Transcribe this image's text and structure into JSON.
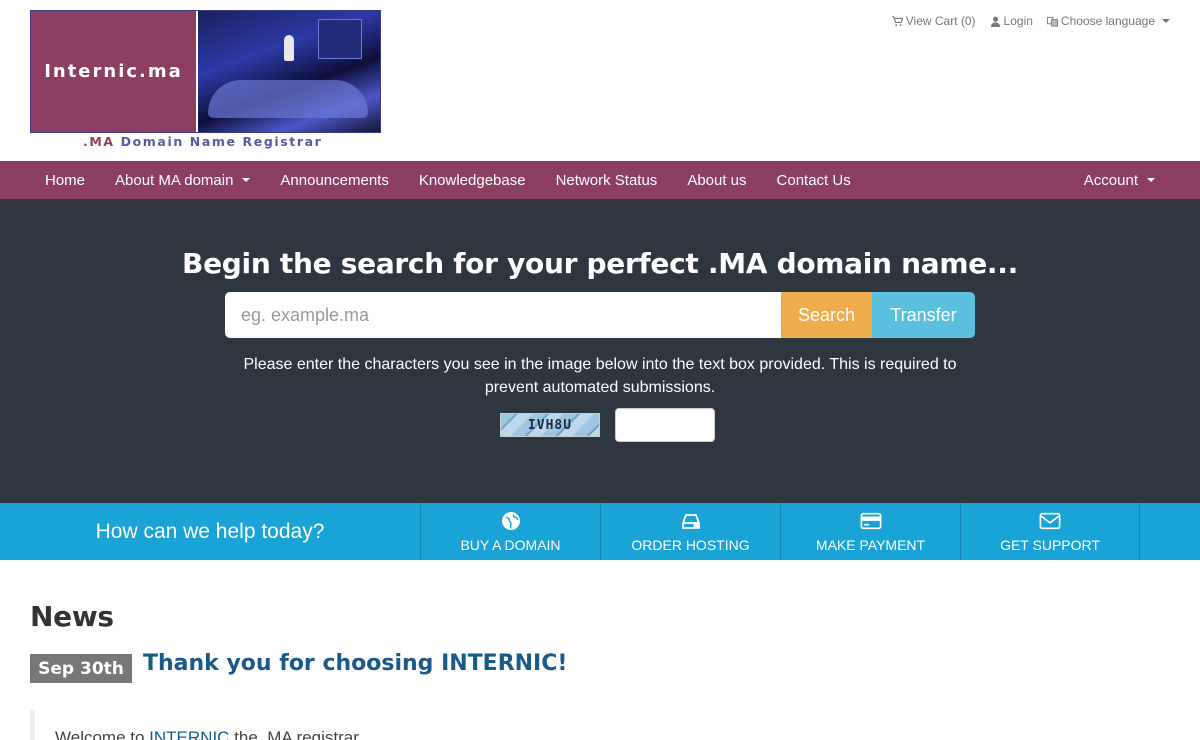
{
  "header": {
    "logo_text": "Internic.ma",
    "tagline_ma": ".MA",
    "tagline_rest": " Domain Name Registrar",
    "top_links": {
      "cart": "View Cart (0)",
      "login": "Login",
      "language": "Choose language"
    }
  },
  "nav": {
    "items": [
      {
        "label": "Home"
      },
      {
        "label": "About MA domain"
      },
      {
        "label": "Announcements"
      },
      {
        "label": "Knowledgebase"
      },
      {
        "label": "Network Status"
      },
      {
        "label": "About us"
      },
      {
        "label": "Contact Us"
      }
    ],
    "account": "Account"
  },
  "hero": {
    "title": "Begin the search for your perfect .MA domain name...",
    "search_placeholder": "eg. example.ma",
    "search_button": "Search",
    "transfer_button": "Transfer",
    "captcha_instructions": "Please enter the characters you see in the image below into the text box provided. This is required to prevent automated submissions.",
    "captcha_code": "IVH8U"
  },
  "help": {
    "title": "How can we help today?",
    "actions": [
      {
        "label": "BUY A DOMAIN",
        "icon": "globe-icon"
      },
      {
        "label": "ORDER HOSTING",
        "icon": "server-icon"
      },
      {
        "label": "MAKE PAYMENT",
        "icon": "credit-card-icon"
      },
      {
        "label": "GET SUPPORT",
        "icon": "envelope-icon"
      }
    ]
  },
  "news": {
    "heading": "News",
    "date": "Sep 30th",
    "title": "Thank you for choosing INTERNIC!",
    "body_prefix": "Welcome to ",
    "body_link": "INTERNIC",
    "body_suffix": " the .MA registrar"
  },
  "colors": {
    "brand": "#8c3f62",
    "hero_bg": "#2e3640",
    "search_btn": "#f0ad4e",
    "transfer_btn": "#5bc0de",
    "help_bar": "#1aa3d6",
    "link": "#1a5a86"
  }
}
